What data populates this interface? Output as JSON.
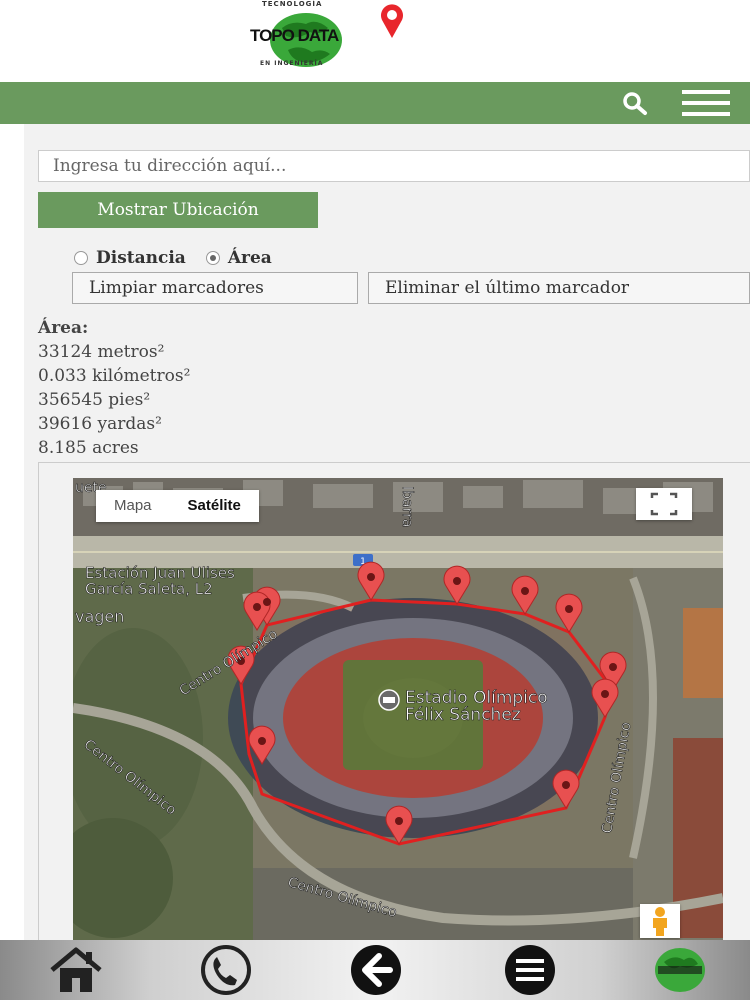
{
  "logo": {
    "text": "TOPO DATA",
    "arc_top": "TECNOLOGÍA",
    "arc_bottom": "EN INGENIERÍA"
  },
  "navbar": {
    "search_icon": "search-icon",
    "menu_icon": "hamburger-icon",
    "color": "#6a9a5e"
  },
  "form": {
    "address_placeholder": "Ingresa tu dirección aquí...",
    "show_location_label": "Mostrar Ubicación",
    "radio_distance": "Distancia",
    "radio_area": "Área",
    "selected_mode": "Área",
    "clear_markers_label": "Limpiar marcadores",
    "remove_last_label": "Eliminar el último marcador"
  },
  "results": {
    "title": "Área:",
    "lines": [
      "33124 metros²",
      "0.033 kilómetros²",
      "356545 pies²",
      "39616 yardas²",
      "8.185 acres"
    ]
  },
  "map": {
    "tab_map": "Mapa",
    "tab_satellite": "Satélite",
    "active_tab": "Satélite",
    "labels": {
      "station_1": "Estación Juan Ulises",
      "station_2": "García Saleta, L2",
      "street_top": "Ibarra",
      "stadium_1": "Estadio Olímpico",
      "stadium_2": "Félix Sánchez",
      "centro_1": "Centro Olímpico",
      "centro_2": "Centro Olímpico",
      "centro_3": "Centro Olímpico",
      "centro_4": "Centro Olímpico",
      "vagen": "vagen",
      "highway": "1",
      "top_left": "uete"
    },
    "polygon_color": "#e02020",
    "marker_color": "#e85050"
  },
  "bottom_bar": {
    "icons": [
      "home-icon",
      "phone-icon",
      "back-arrow-icon",
      "menu-icon",
      "logo-icon"
    ]
  }
}
